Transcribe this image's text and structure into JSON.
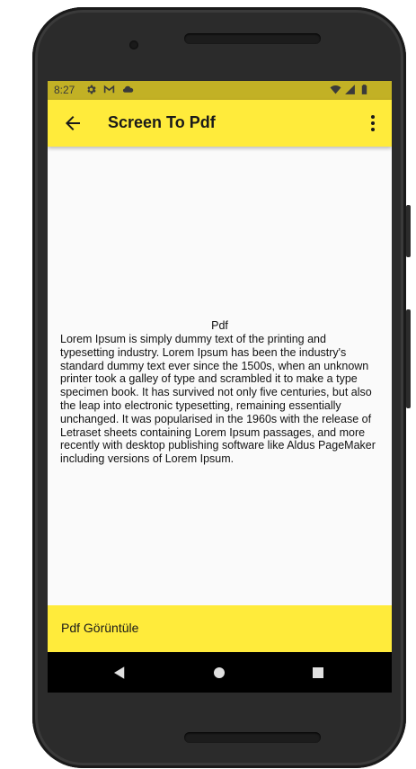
{
  "status_bar": {
    "time": "8:27",
    "left_icons": [
      "gear-icon",
      "gmail-icon",
      "cloud-icon"
    ],
    "right_icons": [
      "wifi-icon",
      "signal-icon",
      "battery-icon"
    ],
    "color": "#c2b125"
  },
  "app_bar": {
    "title": "Screen To Pdf",
    "back_icon": "arrow-back-icon",
    "menu_icon": "more-vert-icon",
    "color": "#ffeb3b"
  },
  "content": {
    "pdf_label": "Pdf",
    "body_text": "Lorem Ipsum is simply dummy text of the printing and typesetting industry. Lorem Ipsum has been the industry's standard dummy text ever since the 1500s, when an unknown printer took a galley of type and scrambled it to make a type specimen book. It has survived not only five centuries, but also the leap into electronic typesetting, remaining essentially unchanged. It was popularised in the 1960s with the release of Letraset sheets containing Lorem Ipsum passages, and more recently with desktop publishing software like Aldus PageMaker including versions of Lorem Ipsum."
  },
  "bottom_bar": {
    "button_label": "Pdf Görüntüle",
    "color": "#ffeb3b"
  },
  "nav_bar": {
    "icons": [
      "nav-back-icon",
      "nav-home-icon",
      "nav-recents-icon"
    ]
  }
}
